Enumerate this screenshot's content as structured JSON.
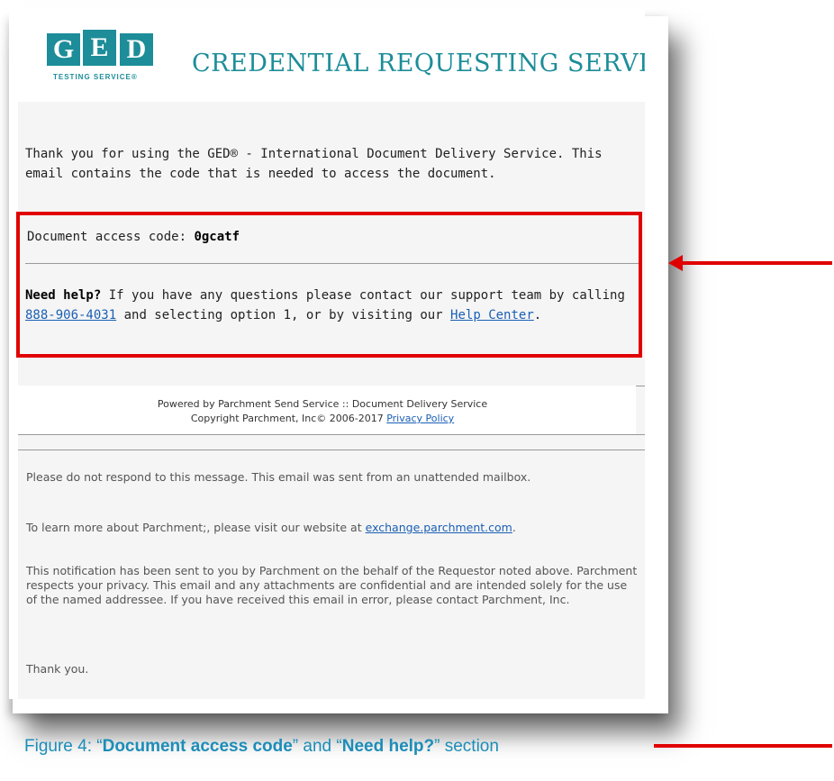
{
  "header": {
    "logo_letters": [
      "G",
      "E",
      "D"
    ],
    "logo_tagline": "TESTING SERVICE®",
    "title": "CREDENTIAL REQUESTING SERVICE"
  },
  "body": {
    "intro": "Thank you for using the GED® - International Document Delivery Service. This email contains the code that is needed to access the document.",
    "access_label": "Document access code:",
    "access_code": "0gcatf",
    "help_bold": "Need help?",
    "help_text_1": "If you have any questions please contact our support team by calling",
    "help_phone": "888-906-4031",
    "help_text_2": "and selecting option 1, or by visiting our",
    "help_center_link": "Help Center",
    "help_period": "."
  },
  "footer": {
    "powered_by": "Powered by Parchment Send Service :: Document Delivery Service",
    "copyright": "Copyright Parchment, Inc© 2006-2017",
    "privacy_link": "Privacy Policy"
  },
  "notices": {
    "no_reply": "Please do not respond to this message. This email was sent from an unattended mailbox.",
    "learn_more": "To learn more about Parchment;, please visit our website at",
    "website_link": "exchange.parchment.com",
    "learn_more_end": ".",
    "confidential": "This notification has been sent to you by Parchment on the behalf of the Requestor noted above. Parchment respects your privacy. This email and any attachments are confidential and are intended solely for the use of the named addressee. If you have received this email in error, please contact Parchment, Inc.",
    "thanks": "Thank you."
  },
  "caption": {
    "prefix": "Figure 4: “",
    "bold1": "Document access code",
    "middle": "” and “",
    "bold2": "Need help?",
    "suffix": "” section"
  },
  "colors": {
    "brand_teal": "#1c8d99",
    "highlight_red": "#e00000",
    "link_blue": "#1a5fb4",
    "caption_blue": "#1c8db8"
  }
}
